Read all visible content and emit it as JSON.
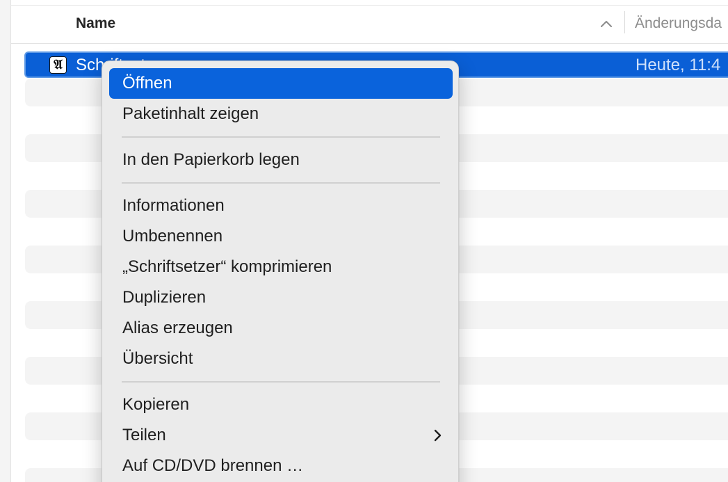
{
  "columns": {
    "name_label": "Name",
    "changed_label": "Änderungsda"
  },
  "file": {
    "name": "Schriftsetzer",
    "date": "Heute, 11:4",
    "icon_glyph": "𝔄"
  },
  "context_menu": {
    "items": [
      {
        "label": "Öffnen"
      },
      {
        "label": "Paketinhalt zeigen"
      },
      {
        "label": "In den Papierkorb legen"
      },
      {
        "label": "Informationen"
      },
      {
        "label": "Umbenennen"
      },
      {
        "label": "„Schriftsetzer“ komprimieren"
      },
      {
        "label": "Duplizieren"
      },
      {
        "label": "Alias erzeugen"
      },
      {
        "label": "Übersicht"
      },
      {
        "label": "Kopieren"
      },
      {
        "label": "Teilen"
      },
      {
        "label": "Auf CD/DVD brennen …"
      }
    ]
  },
  "colors": {
    "selection": "#0a5fd6",
    "menu_highlight": "#0a63dc",
    "menu_background": "#ebebeb"
  },
  "icons": {
    "sort": "chevron-up-icon",
    "submenu": "chevron-right-icon",
    "app": "fraktur-a-app-icon"
  }
}
